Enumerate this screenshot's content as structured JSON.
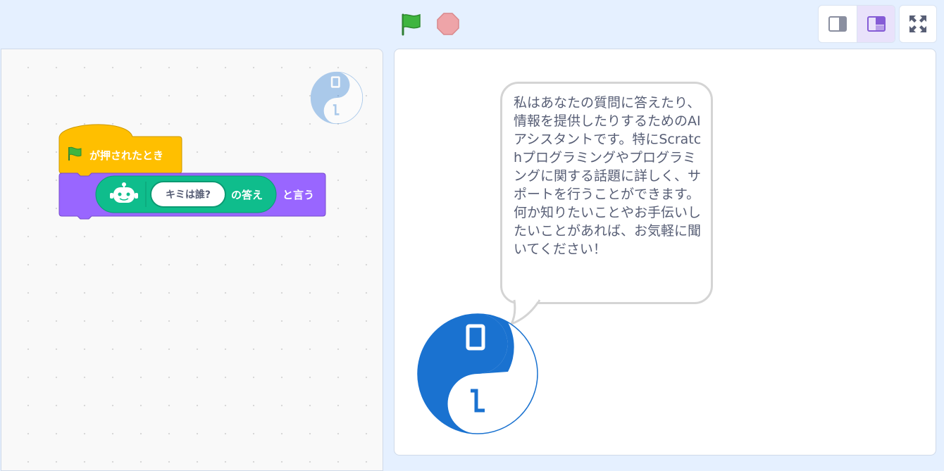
{
  "app": {
    "toolbar": {
      "green_flag_icon": "green-flag-icon",
      "stop_icon": "stop-sign-icon",
      "small_stage_icon": "small-stage-layout-icon",
      "normal_stage_icon": "normal-stage-layout-icon",
      "fullscreen_icon": "fullscreen-icon"
    }
  },
  "workspace": {
    "hat_block": {
      "label": "が押されたとき",
      "icon": "green-flag-icon",
      "color": "#ffbf00"
    },
    "say_block": {
      "label": "と言う",
      "color": "#9966ff"
    },
    "reporter_block": {
      "input_value": "キミは誰?",
      "label": "の答え",
      "icon": "robot-icon",
      "color": "#0fbd8c"
    },
    "sprite_thumbnail_icon": "yin-yang-sprite-icon"
  },
  "stage": {
    "speech_bubble_text": "私はあなたの質問に答えたり、情報を提供したりするためのAIアシスタントです。特にScratchプログラミングやプログラミングに関する話題に詳しく、サポートを行うことができます。何か知りたいことやお手伝いしたいことがあれば、お気軽に聞いてください！",
    "sprite": {
      "icon": "yin-yang-sprite-icon",
      "label_top": "0",
      "label_bottom": "1",
      "color": "#1a72d0"
    }
  }
}
